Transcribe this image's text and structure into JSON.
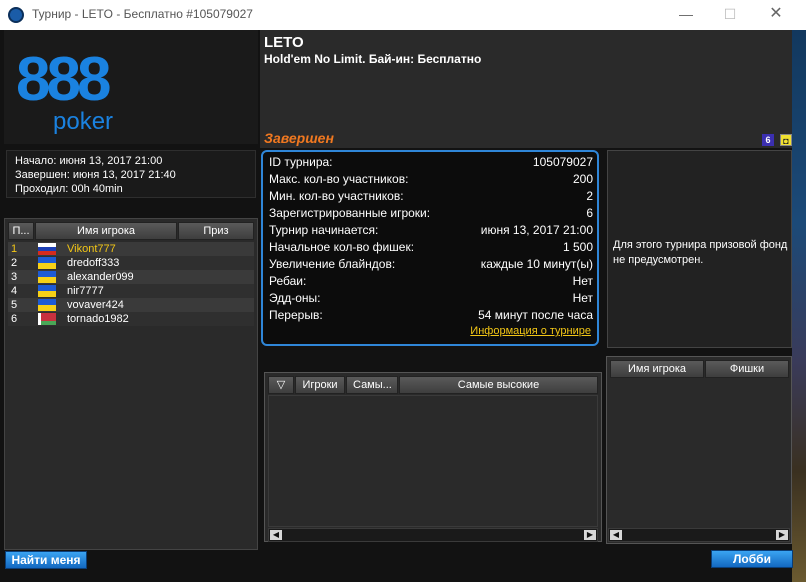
{
  "window": {
    "title": "Турнир - LETO - Бесплатно #105079027",
    "minimize": "—",
    "maximize": "☐",
    "close": "✕"
  },
  "logo": {
    "digits": "888",
    "word": "poker"
  },
  "times": {
    "start": "Начало: июня 13, 2017 21:00",
    "end": "Завершен: июня 13, 2017 21:40",
    "duration": "Проходил: 00h 40min"
  },
  "players": {
    "headers": {
      "pos": "П...",
      "name": "Имя игрока",
      "prize": "Приз"
    },
    "rows": [
      {
        "pos": "1",
        "flag": "ru",
        "name": "Vikont777"
      },
      {
        "pos": "2",
        "flag": "ua",
        "name": "dredoff333"
      },
      {
        "pos": "3",
        "flag": "ua",
        "name": "alexander099"
      },
      {
        "pos": "4",
        "flag": "ua",
        "name": "nir7777"
      },
      {
        "pos": "5",
        "flag": "ua",
        "name": "vovaver424"
      },
      {
        "pos": "6",
        "flag": "by",
        "name": "tornado1982"
      }
    ]
  },
  "buttons": {
    "find_me": "Найти меня",
    "lobby": "Лобби"
  },
  "header": {
    "name": "LETO",
    "game": "Hold'em No Limit. Бай-ин: Бесплатно",
    "status": "Завершен",
    "icon6": "6"
  },
  "info": {
    "rows": [
      {
        "k": "ID турнира:",
        "v": "105079027"
      },
      {
        "k": "Макс. кол-во участников:",
        "v": "200"
      },
      {
        "k": "Мин. кол-во участников:",
        "v": "2"
      },
      {
        "k": "Зарегистрированные игроки:",
        "v": "6"
      },
      {
        "k": "Турнир начинается:",
        "v": "июня 13, 2017 21:00"
      },
      {
        "k": "Начальное кол-во фишек:",
        "v": "1 500"
      },
      {
        "k": "Увеличение блайндов:",
        "v": "каждые 10 минут(ы)"
      },
      {
        "k": "Ребаи:",
        "v": "Нет"
      },
      {
        "k": "Эдд-оны:",
        "v": "Нет"
      },
      {
        "k": "Перерыв:",
        "v": "54 минут после часа"
      }
    ],
    "link": "Информация о турнире"
  },
  "prize_text": "Для этого турнира призовой фонд не предусмотрен.",
  "tables": {
    "headers": {
      "sort": "▽",
      "players": "Игроки",
      "min": "Самы...",
      "max": "Самые высокие"
    }
  },
  "chips": {
    "headers": {
      "name": "Имя игрока",
      "chips": "Фишки"
    }
  }
}
